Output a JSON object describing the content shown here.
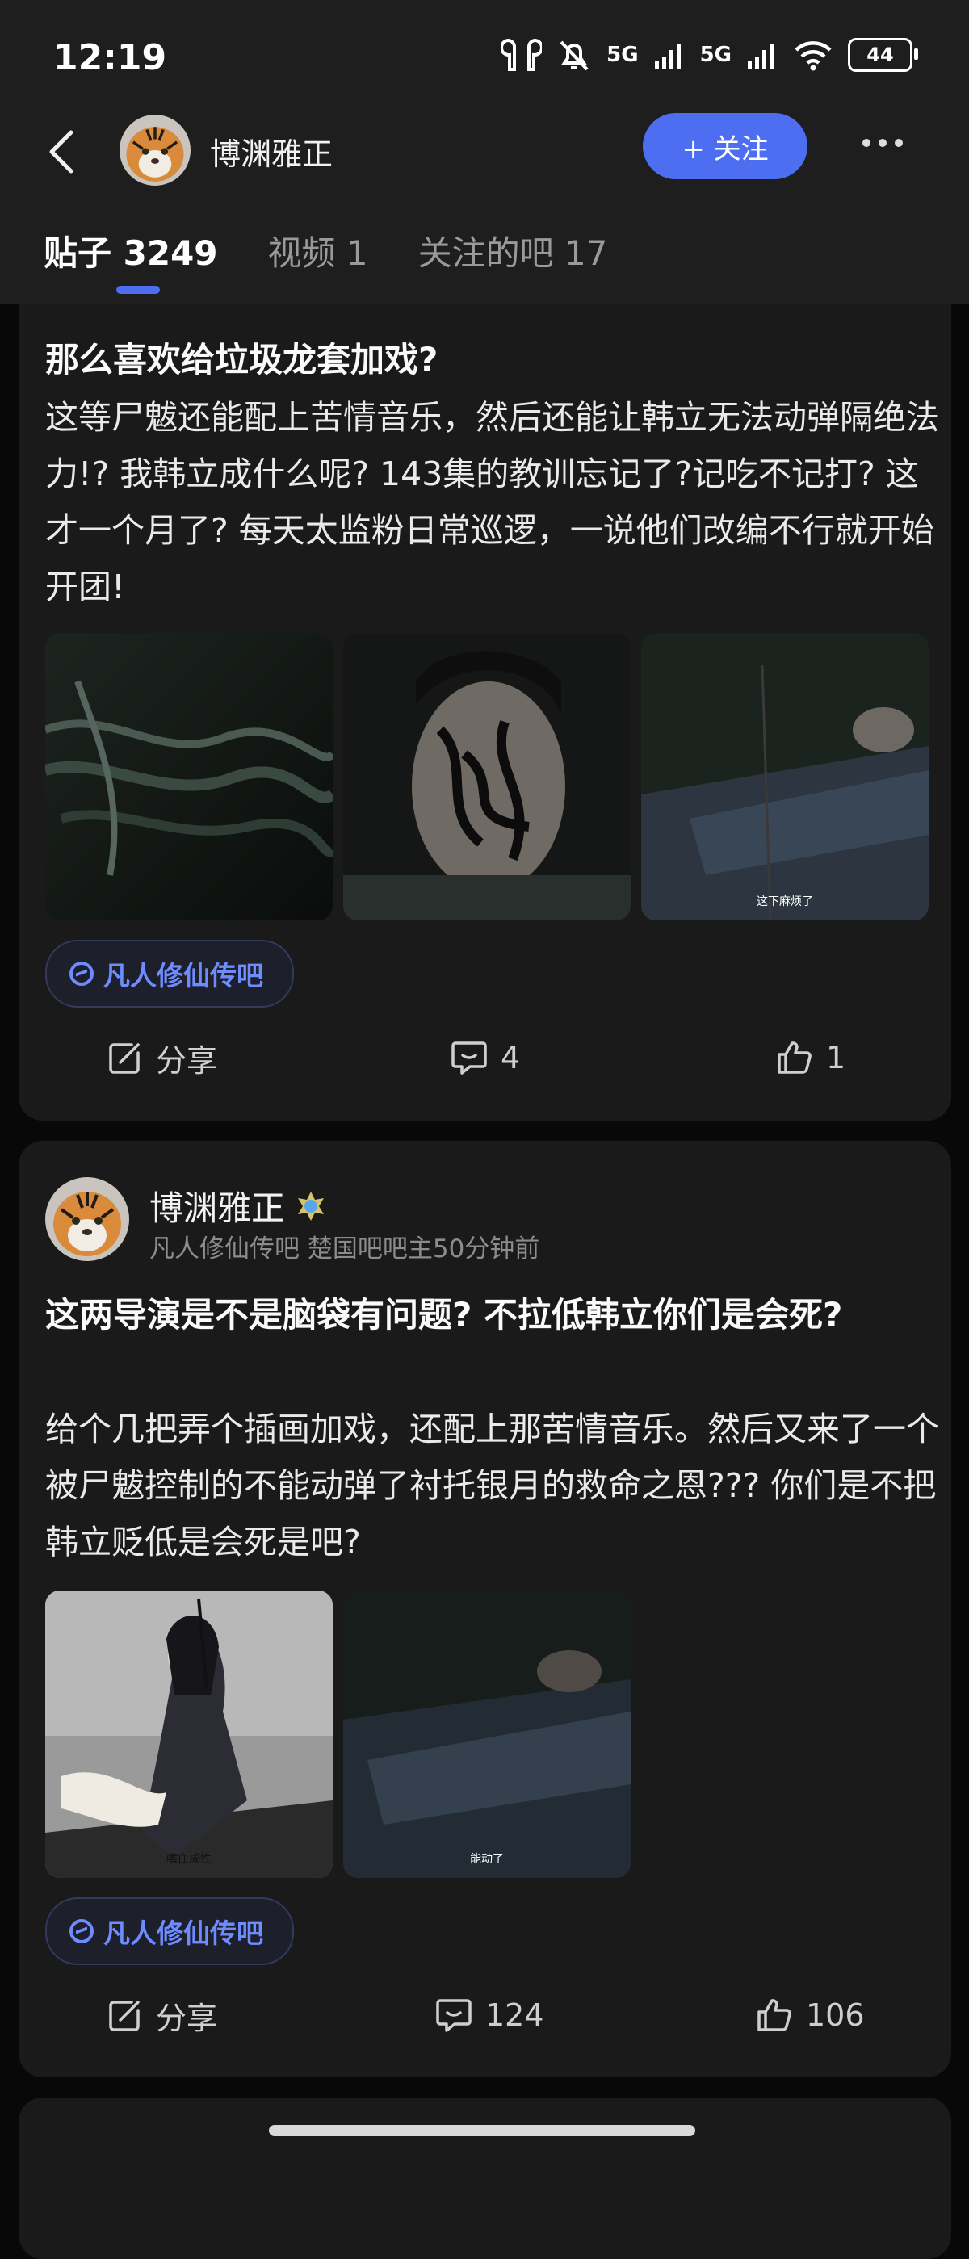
{
  "status_bar": {
    "time": "12:19",
    "signal_1": "5G",
    "signal_2": "5G",
    "battery": "44"
  },
  "header": {
    "nickname": "博渊雅正",
    "follow_label": "+ 关注"
  },
  "tabs": [
    {
      "label": "贴子 3249",
      "active": true
    },
    {
      "label": "视频 1",
      "active": false
    },
    {
      "label": "关注的吧 17",
      "active": false
    }
  ],
  "posts": [
    {
      "title": "那么喜欢给垃圾龙套加戏?",
      "body": "这等尸魃还能配上苦情音乐，然后还能让韩立无法动弹隔绝法力!? 我韩立成什么呢? 143集的教训忘记了?记吃不记打? 这才一个月了? 每天太监粉日常巡逻，一说他们改编不行就开始开团!",
      "images": [
        {
          "caption": ""
        },
        {
          "caption": ""
        },
        {
          "caption": "这下麻烦了"
        }
      ],
      "bar": "凡人修仙传吧",
      "share_label": "分享",
      "comments": "4",
      "likes": "1"
    },
    {
      "author": "博渊雅正",
      "meta": "凡人修仙传吧   楚国吧吧主50分钟前",
      "title": "这两导演是不是脑袋有问题? 不拉低韩立你们是会死?",
      "body": "给个几把弄个插画加戏，还配上那苦情音乐。然后又来了一个被尸魃控制的不能动弹了衬托银月的救命之恩??? 你们是不把韩立贬低是会死是吧?",
      "images": [
        {
          "caption": "嗜血成性"
        },
        {
          "caption": "能动了"
        }
      ],
      "bar": "凡人修仙传吧",
      "share_label": "分享",
      "comments": "124",
      "likes": "106"
    }
  ],
  "colors": {
    "accent": "#4e6ef2",
    "bar_tag": "#6f8cff",
    "card_bg": "#1a1a1a",
    "page_bg": "#080808"
  }
}
